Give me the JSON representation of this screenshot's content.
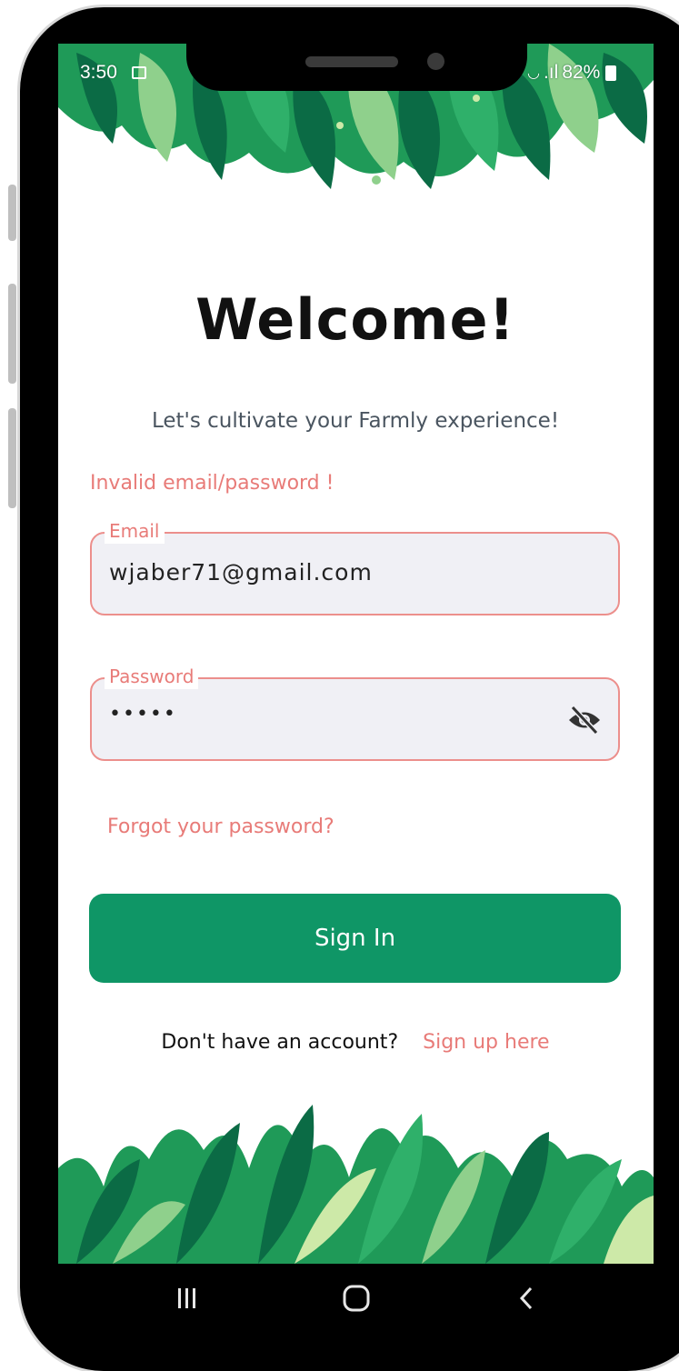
{
  "status_bar": {
    "time": "3:50",
    "battery": "82%",
    "signal": ".ıl"
  },
  "login": {
    "title": "Welcome!",
    "subtitle": "Let's cultivate your Farmly experience!",
    "error": "Invalid email/password !",
    "email": {
      "label": "Email",
      "value": "wjaber71@gmail.com"
    },
    "password": {
      "label": "Password",
      "masked_value": "•••••"
    },
    "forgot_link": "Forgot your password?",
    "signin_button": "Sign In",
    "signup_prompt": "Don't have an account?",
    "signup_link": "Sign up here"
  },
  "colors": {
    "primary": "#0f9666",
    "error": "#e87b78",
    "field_bg": "#f0f0f5",
    "leaf_dark": "#0b6b45",
    "leaf_mid": "#1f9a58",
    "leaf_light": "#8fd08c"
  },
  "icons": {
    "password_toggle": "eye-off-icon",
    "nav_recent": "recent-apps-icon",
    "nav_home": "home-icon",
    "nav_back": "back-icon"
  }
}
